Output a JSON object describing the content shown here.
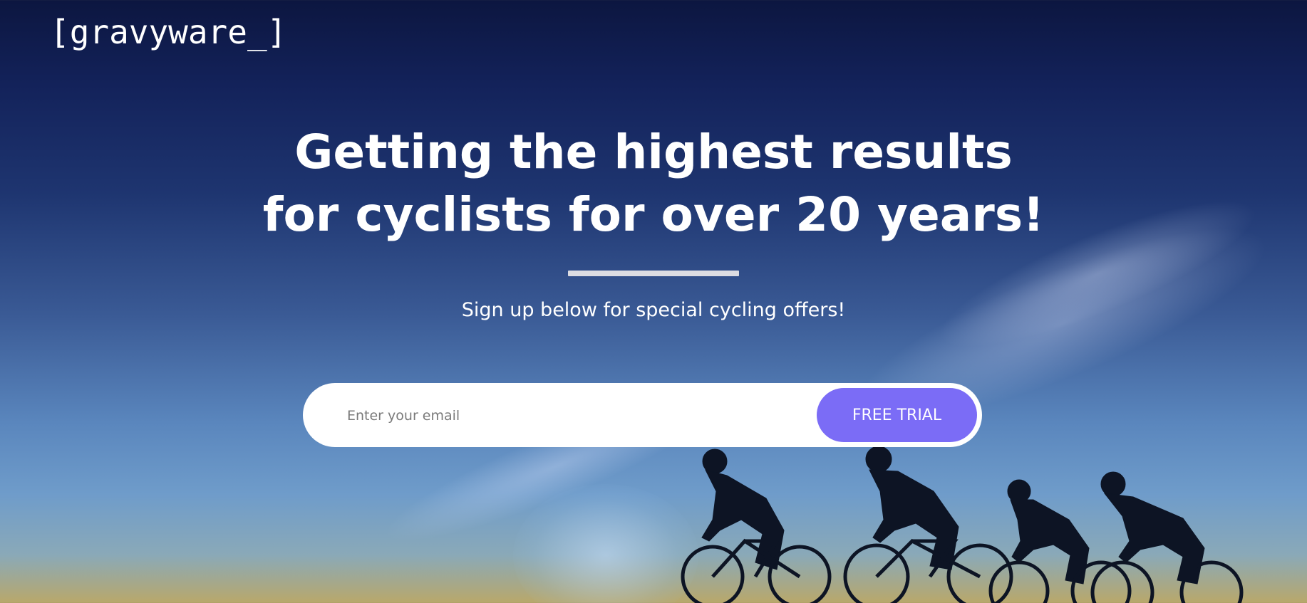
{
  "brand": {
    "logo_text": "[gravyware_]"
  },
  "hero": {
    "headline_line1": "Getting the highest results",
    "headline_line2": "for cyclists for over 20 years!",
    "subtitle": "Sign up below for special cycling offers!"
  },
  "signup": {
    "email_placeholder": "Enter your email",
    "email_value": "",
    "button_label": "FREE TRIAL"
  },
  "colors": {
    "accent": "#7b6cf6",
    "text": "#ffffff",
    "sky_top": "#0c1640",
    "sky_bottom": "#b9a86a"
  }
}
